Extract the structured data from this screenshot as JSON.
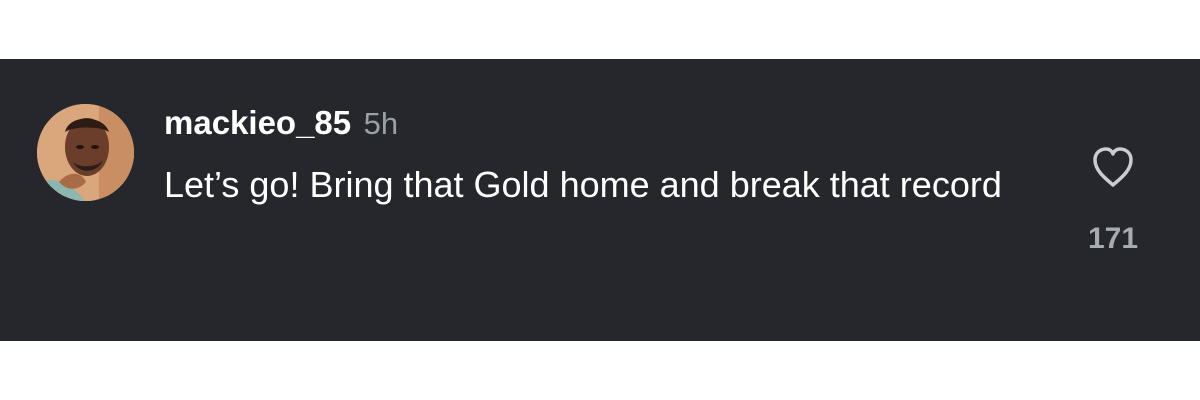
{
  "comment": {
    "username": "mackieo_85",
    "timestamp": "5h",
    "text": "Let’s go! Bring that Gold home and break that record",
    "like_count": "171"
  },
  "icons": {
    "like": "heart-outline-icon"
  },
  "colors": {
    "panel_background": "#25272c",
    "primary_text": "#ffffff",
    "secondary_text": "#9aa0a8",
    "heart_outline": "#c9ccd2"
  }
}
